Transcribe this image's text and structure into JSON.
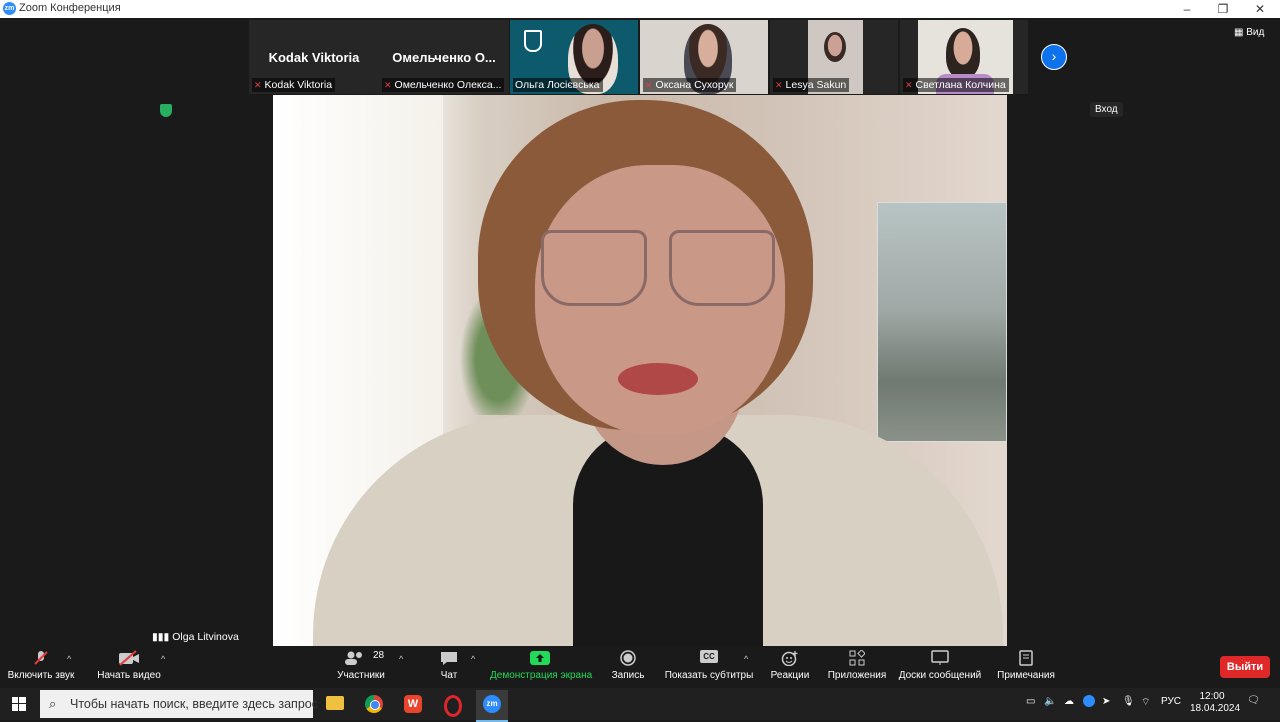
{
  "window": {
    "title": "Zoom Конференция",
    "logo_text": "zm"
  },
  "gallery": {
    "tiles": [
      {
        "big_name": "Kodak Viktoria",
        "label": "Kodak Viktoria",
        "muted": true
      },
      {
        "big_name": "Омельченко  О...",
        "label": "Омельченко Олекса...",
        "muted": true
      },
      {
        "label": "Ольга Лосієвська",
        "muted": false
      },
      {
        "label": "Оксана Сухорук",
        "muted": true
      },
      {
        "label": "Lesya Sakun",
        "muted": true
      },
      {
        "label": "Светлана Колчина",
        "muted": true
      }
    ]
  },
  "view_button": "Вид",
  "enter_label": "Вход",
  "speaker_name": "Olga Litvinova",
  "toolbar": {
    "unmute": "Включить звук",
    "start_video": "Начать видео",
    "participants": "Участники",
    "participants_count": "28",
    "chat": "Чат",
    "share_screen": "Демонстрация экрана",
    "record": "Запись",
    "captions": "Показать субтитры",
    "reactions": "Реакции",
    "apps": "Приложения",
    "whiteboards": "Доски сообщений",
    "notes": "Примечания",
    "leave": "Выйти",
    "cc_glyph": "CC"
  },
  "taskbar": {
    "search_placeholder": "Чтобы начать поиск, введите здесь запрос",
    "language": "РУС",
    "time": "12:00",
    "date": "18.04.2024",
    "zoom_glyph": "zm"
  },
  "colors": {
    "accent": "#0e72ed",
    "share_green": "#23d959",
    "leave_red": "#e02828",
    "mic_red": "#e23b3b"
  }
}
